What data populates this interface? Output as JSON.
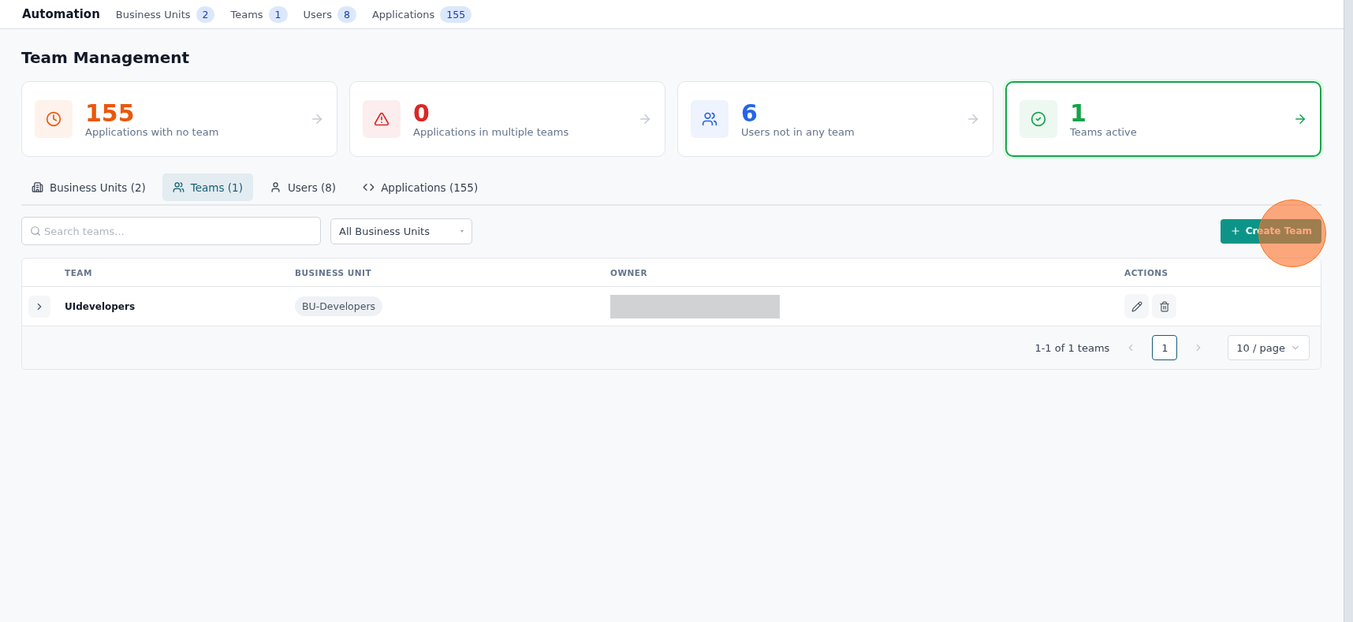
{
  "top_nav": {
    "title": "Automation",
    "items": [
      {
        "label": "Business Units",
        "count": "2"
      },
      {
        "label": "Teams",
        "count": "1"
      },
      {
        "label": "Users",
        "count": "8"
      },
      {
        "label": "Applications",
        "count": "155"
      }
    ]
  },
  "page_title": "Team Management",
  "stat_cards": [
    {
      "kind": "clock",
      "value": "155",
      "label": "Applications with no team",
      "color": "#ea580c",
      "selected": false
    },
    {
      "kind": "warning",
      "value": "0",
      "label": "Applications in multiple teams",
      "color": "#dc2626",
      "selected": false
    },
    {
      "kind": "users",
      "value": "6",
      "label": "Users not in any team",
      "color": "#2563eb",
      "selected": false
    },
    {
      "kind": "check",
      "value": "1",
      "label": "Teams active",
      "color": "#16a34a",
      "selected": true
    }
  ],
  "tabs": [
    {
      "kind": "building",
      "label": "Business Units (2)",
      "selected": false
    },
    {
      "kind": "users",
      "label": "Teams (1)",
      "selected": true
    },
    {
      "kind": "user",
      "label": "Users (8)",
      "selected": false
    },
    {
      "kind": "code",
      "label": "Applications (155)",
      "selected": false
    }
  ],
  "search": {
    "placeholder": "Search teams..."
  },
  "filter": {
    "value": "All Business Units"
  },
  "create_button": {
    "label": "Create Team"
  },
  "table": {
    "columns": [
      "TEAM",
      "BUSINESS UNIT",
      "OWNER",
      "ACTIONS"
    ],
    "rows": [
      {
        "team": "UIdevelopers",
        "business_unit": "BU-Developers",
        "owner_redacted": true
      }
    ]
  },
  "pagination": {
    "summary": "1-1 of 1 teams",
    "pages": [
      {
        "label": "1",
        "selected": true
      }
    ],
    "page_size": "10 / page"
  },
  "click_marker": true
}
